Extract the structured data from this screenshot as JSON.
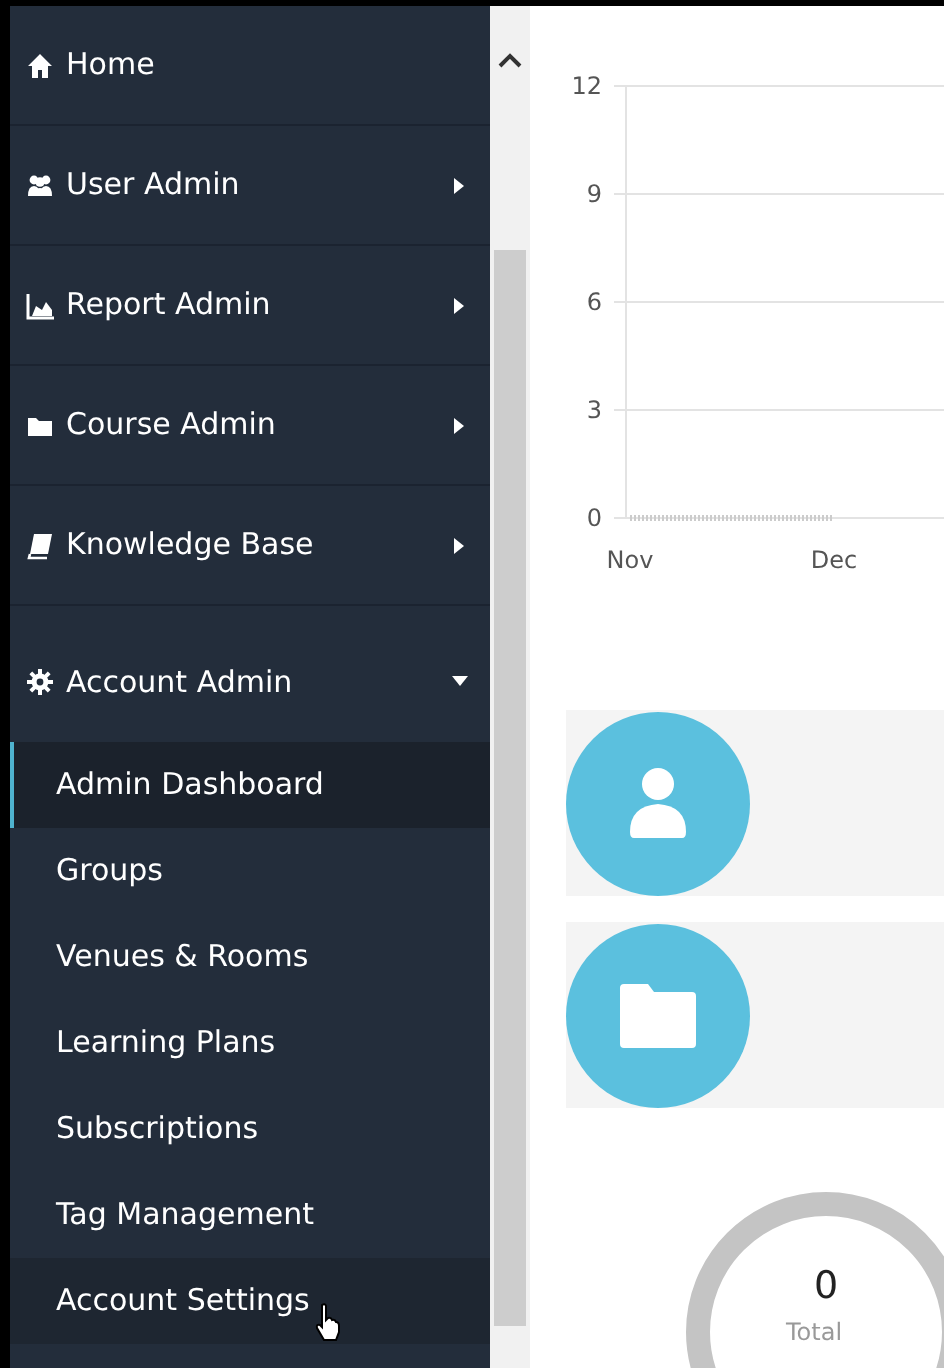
{
  "sidebar": {
    "items": [
      {
        "label": "Home"
      },
      {
        "label": "User Admin",
        "expanded": false
      },
      {
        "label": "Report Admin",
        "expanded": false
      },
      {
        "label": "Course Admin",
        "expanded": false
      },
      {
        "label": "Knowledge Base",
        "expanded": false
      },
      {
        "label": "Account Admin",
        "expanded": true,
        "children": [
          {
            "label": "Admin Dashboard",
            "selected": true,
            "hovered": false
          },
          {
            "label": "Groups",
            "selected": false,
            "hovered": false
          },
          {
            "label": "Venues & Rooms",
            "selected": false,
            "hovered": false
          },
          {
            "label": "Learning Plans",
            "selected": false,
            "hovered": false
          },
          {
            "label": "Subscriptions",
            "selected": false,
            "hovered": false
          },
          {
            "label": "Tag Management",
            "selected": false,
            "hovered": false
          },
          {
            "label": "Account Settings",
            "selected": false,
            "hovered": true
          }
        ]
      }
    ]
  },
  "chart": {
    "chart_data": {
      "type": "line",
      "categories": [
        "Nov",
        "Dec"
      ],
      "yticks": [
        0,
        3,
        6,
        9,
        12
      ],
      "ylim": [
        0,
        12
      ],
      "grid": true,
      "series": [
        {
          "color": "#cccccc",
          "line_style": "dotted",
          "values": [
            0,
            0
          ]
        }
      ]
    }
  },
  "stat_cards": [
    {
      "kind": "user"
    },
    {
      "kind": "folder"
    }
  ],
  "total": {
    "value": "0",
    "label": "Total"
  }
}
